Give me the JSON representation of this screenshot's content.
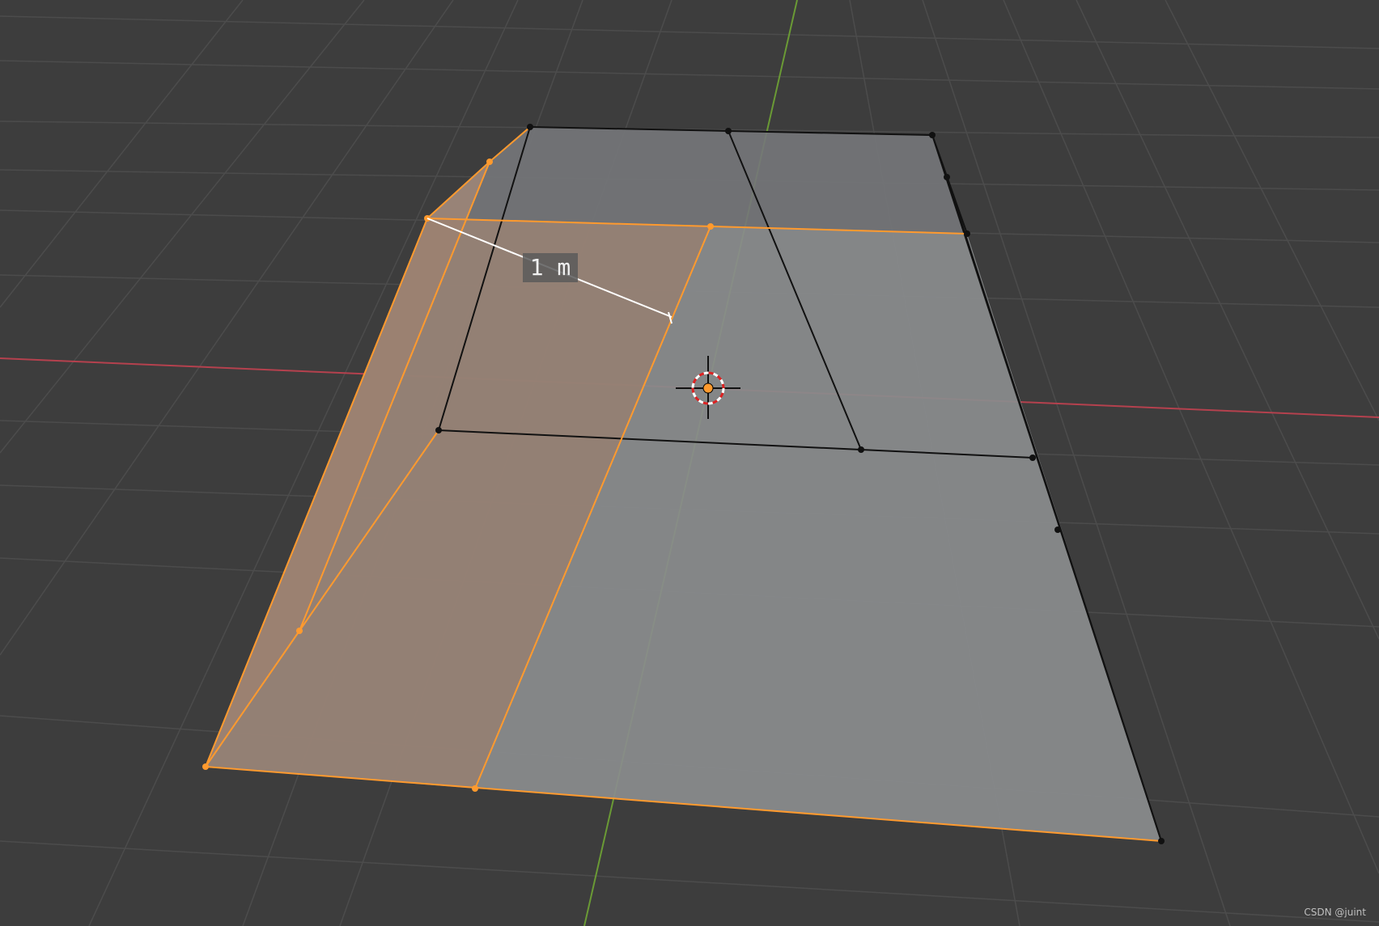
{
  "viewport": {
    "background": "#3d3d3d",
    "grid_color": "#4c4c4c",
    "x_axis_color": "#b5414e",
    "y_axis_color": "#6a9a35",
    "mesh_face_color": "#8a8c8d",
    "selected_color": "#ff9a2e",
    "selected_face_tint": "#9a7e6c",
    "edge_color": "#111111"
  },
  "measure": {
    "label": "1 m"
  },
  "cursor": {
    "icon": "3d-cursor-icon"
  },
  "watermark": "CSDN @juint"
}
